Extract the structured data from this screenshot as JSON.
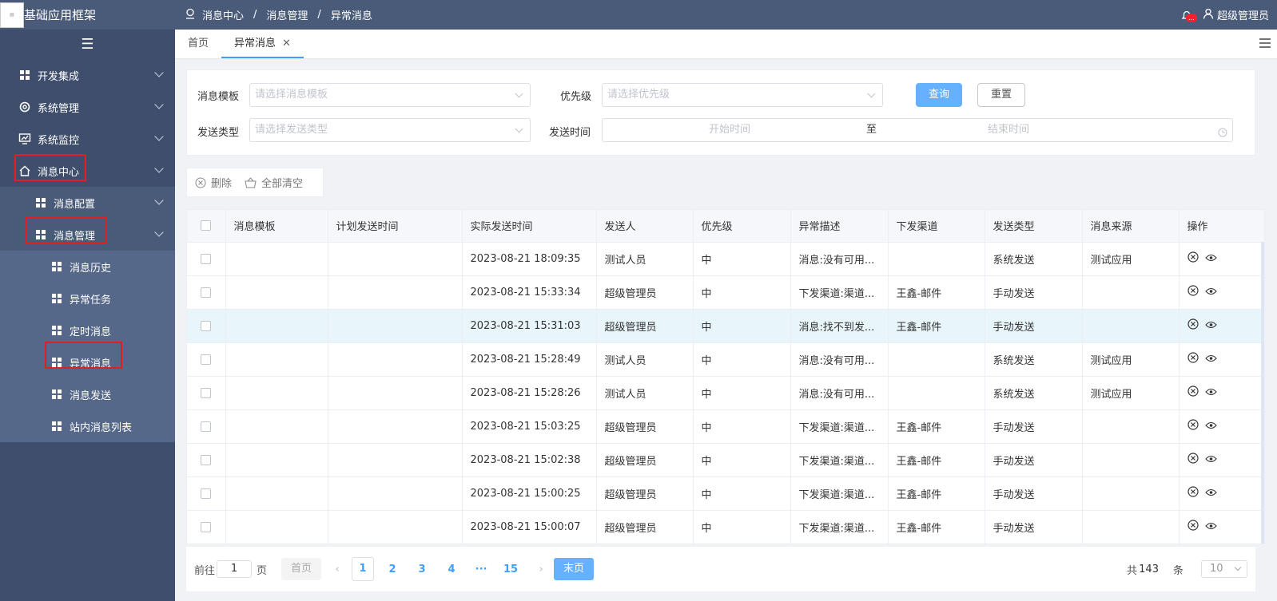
{
  "app": {
    "title": "基础应用框架"
  },
  "sidebar": {
    "items": [
      {
        "label": "开发集成"
      },
      {
        "label": "系统管理"
      },
      {
        "label": "系统监控"
      },
      {
        "label": "消息中心"
      }
    ],
    "sub": [
      {
        "label": "消息配置"
      },
      {
        "label": "消息管理"
      }
    ],
    "leaf": [
      {
        "label": "消息历史"
      },
      {
        "label": "异常任务"
      },
      {
        "label": "定时消息"
      },
      {
        "label": "异常消息"
      },
      {
        "label": "消息发送"
      },
      {
        "label": "站内消息列表"
      }
    ]
  },
  "header": {
    "crumb": [
      "消息中心",
      "消息管理",
      "异常消息"
    ],
    "badge": "...",
    "user": "超级管理员"
  },
  "tabs": [
    {
      "label": "首页"
    },
    {
      "label": "异常消息"
    }
  ],
  "filter": {
    "template_label": "消息模板",
    "template_ph": "请选择消息模板",
    "priority_label": "优先级",
    "priority_ph": "请选择优先级",
    "type_label": "发送类型",
    "type_ph": "请选择发送类型",
    "time_label": "发送时间",
    "start_ph": "开始时间",
    "to": "至",
    "end_ph": "结束时间",
    "query": "查询",
    "reset": "重置"
  },
  "toolbar": {
    "delete": "删除",
    "clear": "全部清空"
  },
  "table": {
    "columns": [
      "消息模板",
      "计划发送时间",
      "实际发送时间",
      "发送人",
      "优先级",
      "异常描述",
      "下发渠道",
      "发送类型",
      "消息来源",
      "操作"
    ],
    "rows": [
      [
        "",
        "",
        "2023-08-21 18:09:35",
        "测试人员",
        "中",
        "消息:没有可用...",
        "",
        "系统发送",
        "测试应用"
      ],
      [
        "",
        "",
        "2023-08-21 15:33:34",
        "超级管理员",
        "中",
        "下发渠道:渠道...",
        "王鑫-邮件",
        "手动发送",
        ""
      ],
      [
        "",
        "",
        "2023-08-21 15:31:03",
        "超级管理员",
        "中",
        "消息:找不到发...",
        "王鑫-邮件",
        "手动发送",
        ""
      ],
      [
        "",
        "",
        "2023-08-21 15:28:49",
        "测试人员",
        "中",
        "消息:没有可用...",
        "",
        "系统发送",
        "测试应用"
      ],
      [
        "",
        "",
        "2023-08-21 15:28:26",
        "测试人员",
        "中",
        "消息:没有可用...",
        "",
        "系统发送",
        "测试应用"
      ],
      [
        "",
        "",
        "2023-08-21 15:03:25",
        "超级管理员",
        "中",
        "下发渠道:渠道...",
        "王鑫-邮件",
        "手动发送",
        ""
      ],
      [
        "",
        "",
        "2023-08-21 15:02:38",
        "超级管理员",
        "中",
        "下发渠道:渠道...",
        "王鑫-邮件",
        "手动发送",
        ""
      ],
      [
        "",
        "",
        "2023-08-21 15:00:25",
        "超级管理员",
        "中",
        "下发渠道:渠道...",
        "王鑫-邮件",
        "手动发送",
        ""
      ],
      [
        "",
        "",
        "2023-08-21 15:00:07",
        "超级管理员",
        "中",
        "下发渠道:渠道...",
        "王鑫-邮件",
        "手动发送",
        ""
      ]
    ]
  },
  "pager": {
    "goto": "前往",
    "page_input": "1",
    "page_unit": "页",
    "first": "首页",
    "pages": [
      "1",
      "2",
      "3",
      "4",
      "···",
      "15"
    ],
    "last": "末页",
    "total_prefix": "共",
    "total": "143",
    "total_unit": "条",
    "size": "10"
  }
}
